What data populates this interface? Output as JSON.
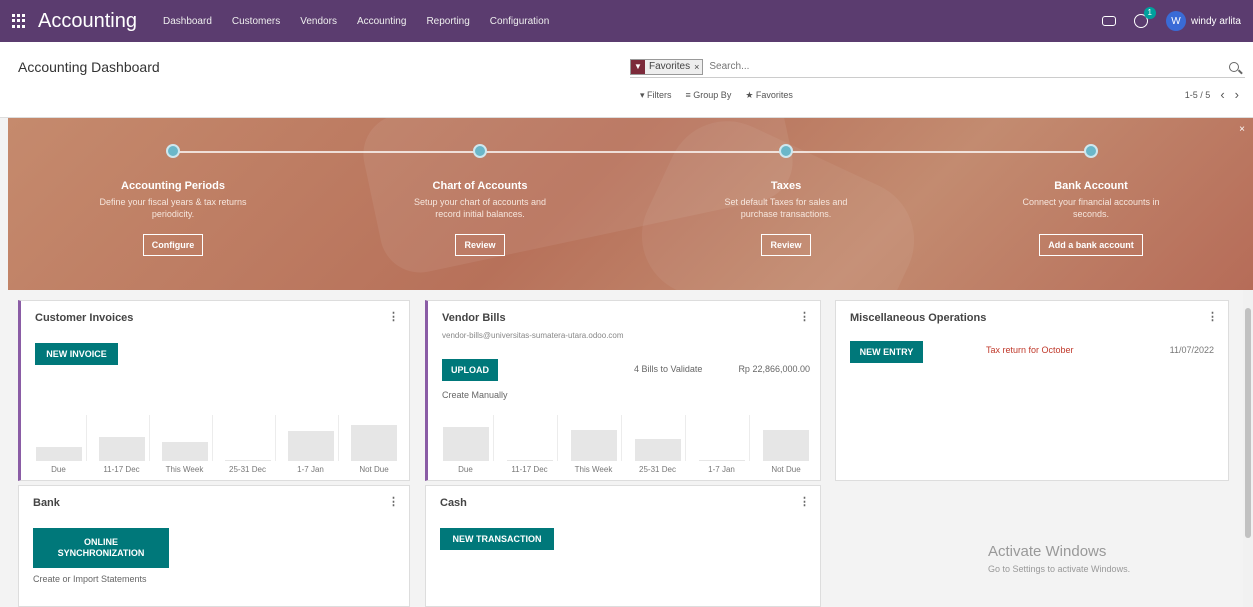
{
  "navbar": {
    "brand": "Accounting",
    "menu": [
      "Dashboard",
      "Customers",
      "Vendors",
      "Accounting",
      "Reporting",
      "Configuration"
    ],
    "activity_count": "1",
    "user_initial": "W",
    "user_name": "windy arlita",
    "bg_color": "#5b3c6f"
  },
  "control": {
    "title": "Accounting Dashboard",
    "facet_label": "Favorites",
    "search_placeholder": "Search...",
    "filters": "Filters",
    "group_by": "Group By",
    "favorites": "Favorites",
    "pager": "1-5 / 5",
    "prev": "‹",
    "next": "›"
  },
  "banner": {
    "steps": [
      {
        "title": "Accounting Periods",
        "desc": "Define your fiscal years & tax returns periodicity.",
        "button": "Configure"
      },
      {
        "title": "Chart of Accounts",
        "desc": "Setup your chart of accounts and record initial balances.",
        "button": "Review"
      },
      {
        "title": "Taxes",
        "desc": "Set default Taxes for sales and purchase transactions.",
        "button": "Review"
      },
      {
        "title": "Bank Account",
        "desc": "Connect your financial accounts in seconds.",
        "button": "Add a bank account"
      }
    ],
    "close": "×"
  },
  "cards": {
    "customer_invoices": {
      "title": "Customer Invoices",
      "button": "NEW INVOICE",
      "bar_labels": [
        "Due",
        "11-17 Dec",
        "This Week",
        "25-31 Dec",
        "1-7 Jan",
        "Not Due"
      ]
    },
    "vendor_bills": {
      "title": "Vendor Bills",
      "email": "vendor-bills@universitas-sumatera-utara.odoo.com",
      "button": "UPLOAD",
      "create_manually": "Create Manually",
      "bills_to_validate": "4 Bills to Validate",
      "amount": "Rp 22,866,000.00",
      "bar_labels": [
        "Due",
        "11-17 Dec",
        "This Week",
        "25-31 Dec",
        "1-7 Jan",
        "Not Due"
      ]
    },
    "misc_operations": {
      "title": "Miscellaneous Operations",
      "button": "NEW ENTRY",
      "reference": "Tax return for October",
      "date": "11/07/2022"
    },
    "bank": {
      "title": "Bank",
      "button_line1": "ONLINE",
      "button_line2": "SYNCHRONIZATION",
      "link": "Create or Import Statements"
    },
    "cash": {
      "title": "Cash",
      "button": "NEW TRANSACTION"
    },
    "menu_icon": "⋮"
  },
  "watermark": {
    "line1": "Activate Windows",
    "line2": "Go to Settings to activate Windows."
  },
  "colors": {
    "accent_purple": "#8a5ca5",
    "teal_button": "#00787a",
    "banner": "#b7715a"
  }
}
